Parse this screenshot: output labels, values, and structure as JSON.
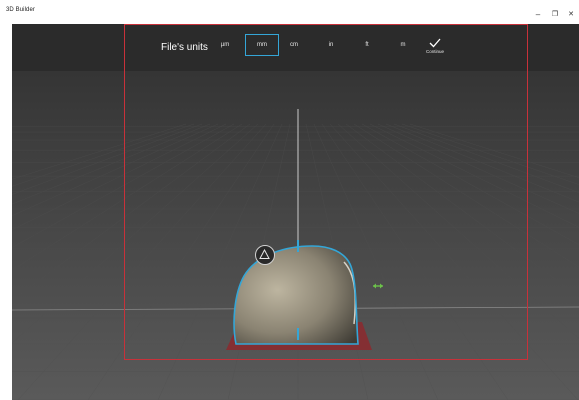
{
  "app": {
    "title": "3D Builder",
    "controls": {
      "minimize": "–",
      "maximize": "❐",
      "close": "✕"
    }
  },
  "toolbar": {
    "label": "File's units",
    "units": [
      "µm",
      "mm",
      "cm",
      "in",
      "ft",
      "m"
    ],
    "selected_unit": "mm",
    "continue_label": "Continue"
  },
  "colors": {
    "selection_accent": "#34a6d7",
    "frame_border": "#c8313a",
    "scale_handle": "#6cc24a"
  },
  "icons": {
    "continue": "checkmark-icon",
    "rotate": "triangle-icon",
    "scale": "double-arrow-icon"
  }
}
